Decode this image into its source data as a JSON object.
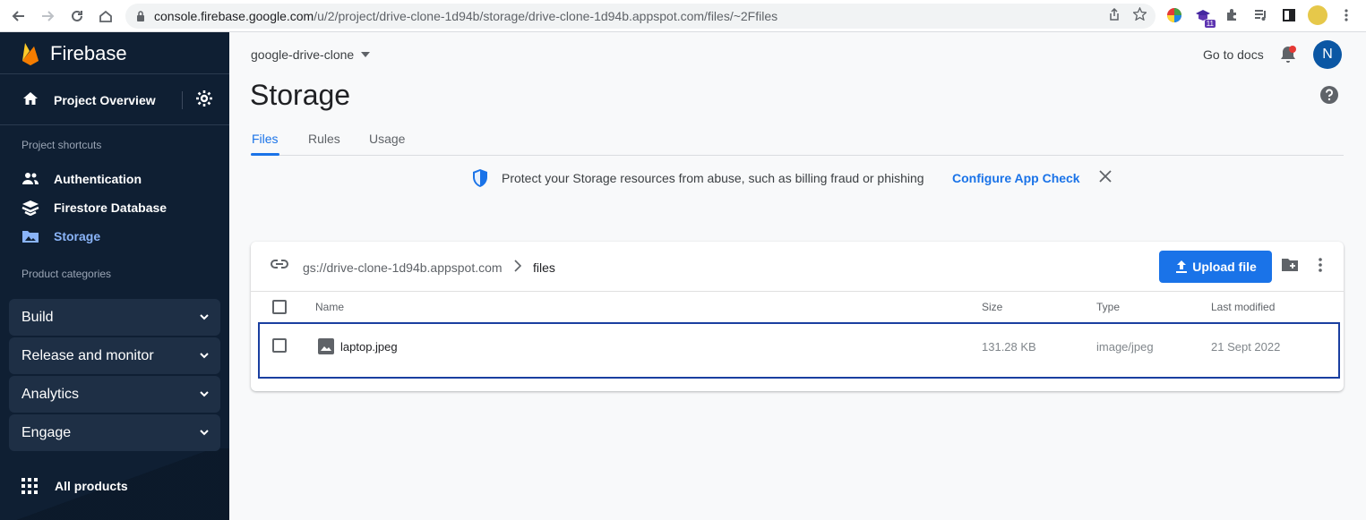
{
  "browser": {
    "url_host": "console.firebase.google.com",
    "url_path": "/u/2/project/drive-clone-1d94b/storage/drive-clone-1d94b.appspot.com/files/~2Ffiles",
    "extension_badge": "11",
    "icons": [
      "back-icon",
      "forward-icon",
      "reload-icon",
      "home-icon",
      "lock-icon",
      "share-icon",
      "star-icon",
      "extensions-icon",
      "media-icon",
      "sidepanel-icon",
      "menu-icon"
    ]
  },
  "sidebar": {
    "brand": "Firebase",
    "project_overview": "Project Overview",
    "shortcuts_title": "Project shortcuts",
    "shortcuts": [
      {
        "label": "Authentication",
        "icon": "people-icon"
      },
      {
        "label": "Firestore Database",
        "icon": "firestore-icon"
      },
      {
        "label": "Storage",
        "icon": "storage-icon",
        "active": true
      }
    ],
    "categories_title": "Product categories",
    "categories": [
      "Build",
      "Release and monitor",
      "Analytics",
      "Engage"
    ],
    "all_products": "All products"
  },
  "header": {
    "project_name": "google-drive-clone",
    "go_to_docs": "Go to docs",
    "avatar_initial": "N"
  },
  "page": {
    "title": "Storage",
    "tabs": [
      "Files",
      "Rules",
      "Usage"
    ],
    "active_tab": "Files"
  },
  "banner": {
    "message": "Protect your Storage resources from abuse, such as billing fraud or phishing",
    "link": "Configure App Check"
  },
  "browser_panel": {
    "bucket": "gs://drive-clone-1d94b.appspot.com",
    "folder": "files",
    "upload_label": "Upload file",
    "columns": [
      "Name",
      "Size",
      "Type",
      "Last modified"
    ],
    "files": [
      {
        "name": "laptop.jpeg",
        "size": "131.28 KB",
        "type": "image/jpeg",
        "modified": "21 Sept 2022"
      }
    ]
  },
  "colors": {
    "sidebar_bg": "#0f1f33",
    "accent": "#1a73e8",
    "active_nav": "#8ab4f8",
    "avatar": "#0b57a4"
  }
}
